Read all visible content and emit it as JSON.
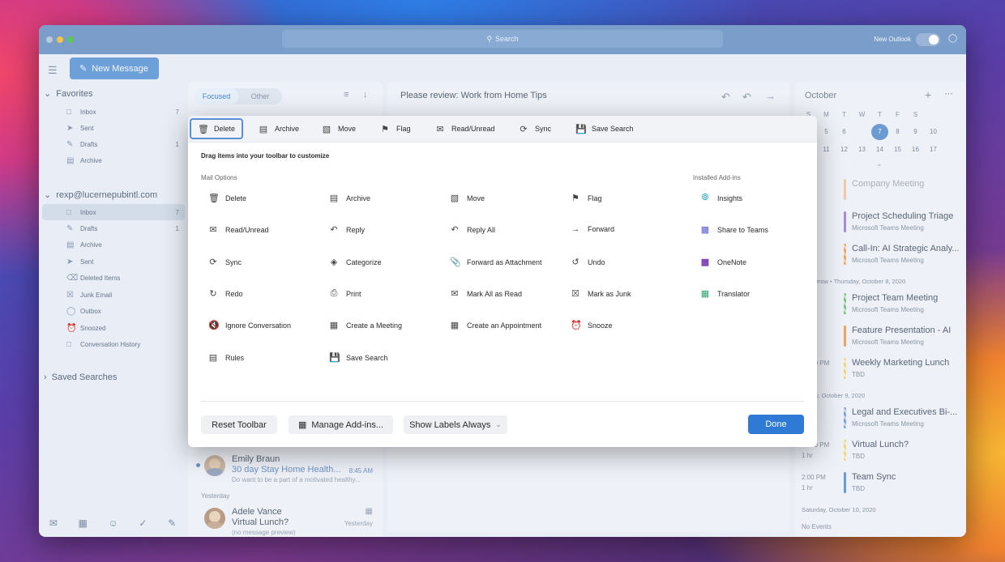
{
  "titlebar": {
    "search_placeholder": "Search",
    "new_outlook_label": "New Outlook"
  },
  "new_message_label": "New Message",
  "sidebar": {
    "favorites_header": "Favorites",
    "favorites": [
      {
        "label": "Inbox",
        "count": "7",
        "icon": "inbox-icon"
      },
      {
        "label": "Sent",
        "count": "",
        "icon": "sent-icon"
      },
      {
        "label": "Drafts",
        "count": "1",
        "icon": "drafts-icon"
      },
      {
        "label": "Archive",
        "count": "",
        "icon": "archive-icon"
      }
    ],
    "account_header": "rexp@lucernepubintl.com",
    "account_folders": [
      {
        "label": "Inbox",
        "count": "7"
      },
      {
        "label": "Drafts",
        "count": "1"
      },
      {
        "label": "Archive",
        "count": ""
      },
      {
        "label": "Sent",
        "count": ""
      },
      {
        "label": "Deleted Items",
        "count": ""
      },
      {
        "label": "Junk Email",
        "count": ""
      },
      {
        "label": "Outbox",
        "count": ""
      },
      {
        "label": "Snoozed",
        "count": ""
      },
      {
        "label": "Conversation History",
        "count": ""
      }
    ],
    "saved_searches_header": "Saved Searches"
  },
  "mail_list": {
    "tabs": [
      "Focused",
      "Other"
    ],
    "emails": [
      {
        "sender": "Emily Braun",
        "subject": "30 day Stay Home Health...",
        "time": "8:45 AM",
        "preview": "Do want to be a part of a motivated healthy..."
      },
      {
        "sender": "Adele Vance",
        "subject": "Virtual Lunch?",
        "time": "Yesterday",
        "preview": "(no message preview)"
      }
    ],
    "group_yesterday": "Yesterday"
  },
  "reader": {
    "title": "Please review: Work from Home Tips"
  },
  "calendar": {
    "month": "October",
    "weekdays": [
      "S",
      "M",
      "T",
      "W",
      "T",
      "F",
      "S"
    ],
    "week1": [
      "4",
      "5",
      "6",
      "7",
      "8",
      "9",
      "10"
    ],
    "week2": [
      "11",
      "12",
      "13",
      "14",
      "15",
      "16",
      "17"
    ],
    "today": "7",
    "events_today": [
      {
        "time": "AM",
        "dur": "30m",
        "title": "Company Meeting",
        "sub": "",
        "color": "#f0c9a8"
      },
      {
        "time": "PM",
        "dur": "30m",
        "title": "Project Scheduling Triage",
        "sub": "Microsoft Teams Meeting",
        "color": "#a48fd6"
      },
      {
        "time": "PM",
        "dur": "hr",
        "title": "Call-In: AI Strategic Analy...",
        "sub": "Microsoft Teams Meeting",
        "color": "#f0a35c"
      }
    ],
    "day2_header": "Tomorrow • Thursday, October 8, 2020",
    "events_day2": [
      {
        "time": "AM",
        "dur": "30m",
        "title": "Project Team Meeting",
        "sub": "Microsoft Teams Meeting",
        "color": "#7cc57f"
      },
      {
        "time": "AM",
        "dur": "30m",
        "title": "Feature Presentation - AI",
        "sub": "Microsoft Teams Meeting",
        "color": "#f0a35c"
      },
      {
        "time": "12:30 PM",
        "dur": "hr",
        "title": "Weekly Marketing Lunch",
        "sub": "TBD",
        "color": "#f3d27a"
      }
    ],
    "day3_header": "Friday, October 9, 2020",
    "events_day3": [
      {
        "time": "AM",
        "dur": "30m",
        "title": "Legal and Executives Bi-...",
        "sub": "Microsoft Teams Meeting",
        "color": "#7ea3dc"
      },
      {
        "time": "12:30 PM",
        "dur": "1 hr",
        "title": "Virtual Lunch?",
        "sub": "TBD",
        "color": "#f3d27a"
      },
      {
        "time": "2:00 PM",
        "dur": "1 hr",
        "title": "Team Sync",
        "sub": "TBD",
        "color": "#6c9bd2"
      }
    ],
    "day4_header": "Saturday, October 10, 2020",
    "no_events": "No Events"
  },
  "customize": {
    "toolbar": [
      {
        "label": "Delete",
        "icon": "trash-icon"
      },
      {
        "label": "Archive",
        "icon": "archive-icon"
      },
      {
        "label": "Move",
        "icon": "move-icon"
      },
      {
        "label": "Flag",
        "icon": "flag-icon"
      },
      {
        "label": "Read/Unread",
        "icon": "envelope-icon"
      },
      {
        "label": "Sync",
        "icon": "sync-icon"
      },
      {
        "label": "Save Search",
        "icon": "save-search-icon"
      }
    ],
    "hint": "Drag items into your toolbar to customize",
    "mail_options_header": "Mail Options",
    "addins_header": "Installed Add-ins",
    "options": [
      [
        "Delete",
        "Archive",
        "Move",
        "Flag"
      ],
      [
        "Read/Unread",
        "Reply",
        "Reply All",
        "Forward"
      ],
      [
        "Sync",
        "Categorize",
        "Forward as Attachment",
        "Undo"
      ],
      [
        "Redo",
        "Print",
        "Mark All as Read",
        "Mark as Junk"
      ],
      [
        "Ignore Conversation",
        "Create a Meeting",
        "Create an Appointment",
        "Snooze"
      ],
      [
        "Rules",
        "Save Search",
        "",
        ""
      ]
    ],
    "addins": [
      "Insights",
      "Share to Teams",
      "OneNote",
      "Translator"
    ],
    "reset_label": "Reset Toolbar",
    "manage_label": "Manage Add-ins...",
    "show_labels_value": "Show Labels Always",
    "done_label": "Done"
  }
}
